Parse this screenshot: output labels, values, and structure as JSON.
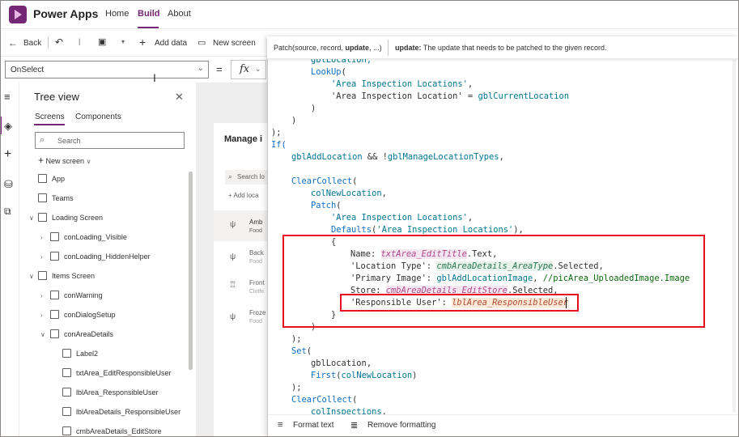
{
  "header": {
    "app_name": "Power Apps",
    "nav": [
      "Home",
      "Build",
      "About"
    ]
  },
  "toolbar": {
    "back": "Back",
    "add_data": "Add data",
    "new_screen": "New screen"
  },
  "formula_bar": {
    "property": "OnSelect",
    "equals": "=",
    "fx": "fx"
  },
  "signature": {
    "func": "Patch(source, record, ",
    "param": "update",
    "rest": ", ...)",
    "desc_bold": "update:",
    "desc": " The update that needs to be patched to the given record."
  },
  "tree": {
    "title": "Tree view",
    "tabs": [
      "Screens",
      "Components"
    ],
    "search_placeholder": "Search",
    "new_screen": "New screen",
    "items": [
      "App",
      "Teams",
      "Loading Screen",
      "conLoading_Visible",
      "conLoading_HiddenHelper",
      "Items Screen",
      "conWarning",
      "conDialogSetup",
      "conAreaDetails",
      "Label2",
      "txtArea_EditResponsibleUser",
      "lblArea_ResponsibleUser",
      "lblAreaDetails_ResponsibleUser",
      "cmbAreaDetails_EditStore"
    ]
  },
  "canvas": {
    "title": "Manage i",
    "search": "Search lo",
    "add": "Add loca",
    "rows": [
      {
        "name": "Amb",
        "sub": "Food"
      },
      {
        "name": "Back",
        "sub": "Food"
      },
      {
        "name": "Front",
        "sub": "Clothi"
      },
      {
        "name": "Froze",
        "sub": "Food"
      }
    ]
  },
  "code": {
    "l01": "gblLocation,",
    "l02a": "LookUp",
    "l02b": "(",
    "l03": "'Area Inspection Locations'",
    "l04a": "'Area Inspection Location'",
    "l04b": " = ",
    "l04c": "gblCurrentLocation",
    "l05": ")",
    "l06": ")",
    "l07": ");",
    "l08": "If(",
    "l09a": "gblAddLocation",
    "l09b": " && !",
    "l09c": "gblManageLocationTypes",
    "l10a": "ClearCollect",
    "l11a": "colNewLocation",
    "l12a": "Patch",
    "l13a": "'Area Inspection Locations'",
    "l14a": "Defaults",
    "l14b": "'Area Inspection Locations'",
    "l15": "{",
    "l16a": "Name: ",
    "l16b": "txtArea_EditTitle",
    "l16c": ".Text,",
    "l17a": "'Location Type'",
    "l17b": ": ",
    "l17c": "cmbAreaDetails_AreaType",
    "l17d": ".Selected,",
    "l18a": "'Primary Image'",
    "l18b": ": ",
    "l18c": "gblAddLocationImage",
    "l18d": ", ",
    "l18e": "//picArea_UploadedImage.Image",
    "l19a": "Store: ",
    "l19b": "cmbAreaDetails_EditStore",
    "l19c": ".Selected,",
    "l20a": "'Responsible User'",
    "l20b": ": ",
    "l20c": "lblArea_ResponsibleUser",
    "l21": "}",
    "l22": ")",
    "l23": ");",
    "l24a": "Set",
    "l25a": "gblLocation,",
    "l26a": "First",
    "l26b": "colNewLocation",
    "l27": ");",
    "l28a": "ClearCollect",
    "l29a": "colInspections"
  },
  "bottom": {
    "format_text": "Format text",
    "remove_formatting": "Remove formatting"
  }
}
